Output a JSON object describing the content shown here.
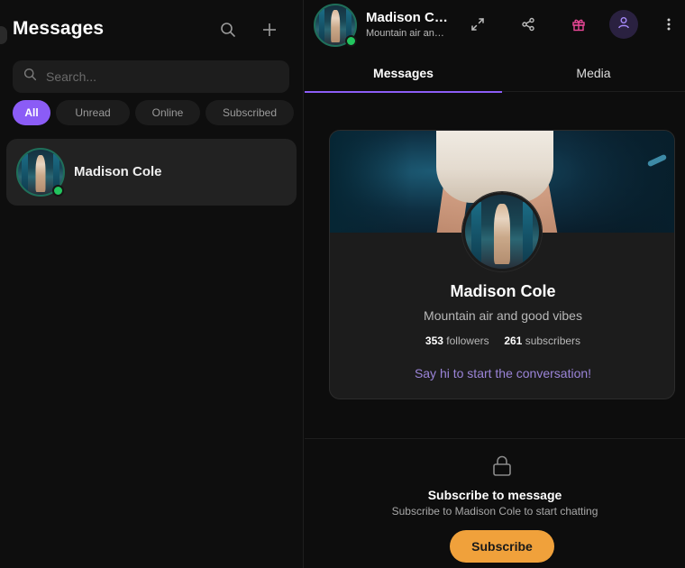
{
  "sidebar": {
    "title": "Messages",
    "icons": {
      "search": "search-icon",
      "new": "plus-icon"
    },
    "search": {
      "placeholder": "Search...",
      "value": ""
    },
    "filters": [
      {
        "label": "All",
        "active": true
      },
      {
        "label": "Unread",
        "active": false
      },
      {
        "label": "Online",
        "active": false
      },
      {
        "label": "Subscribed",
        "active": false
      }
    ],
    "conversations": [
      {
        "name": "Madison Cole",
        "online": true
      }
    ]
  },
  "chat": {
    "header": {
      "name": "Madison Cole",
      "status": "Mountain air and good vibes",
      "icons": [
        "expand-icon",
        "share-icon",
        "gift-icon",
        "profile-icon",
        "more-icon"
      ]
    },
    "tabs": [
      {
        "label": "Messages",
        "active": true
      },
      {
        "label": "Media",
        "active": false
      }
    ],
    "profile_card": {
      "name": "Madison Cole",
      "bio": "Mountain air and good vibes",
      "followers_count": "353",
      "followers_label": "followers",
      "subscribers_count": "261",
      "subscribers_label": "subscribers",
      "cta": "Say hi to start the conversation!"
    },
    "subscribe": {
      "title": "Subscribe to message",
      "description": "Subscribe to Madison Cole to start chatting",
      "button_label": "Subscribe"
    }
  },
  "colors": {
    "accent": "#8b5cf6",
    "online": "#22c55e",
    "subscribe": "#f0a13b",
    "gift": "#ec4899",
    "cta_text": "#9b84d8"
  }
}
